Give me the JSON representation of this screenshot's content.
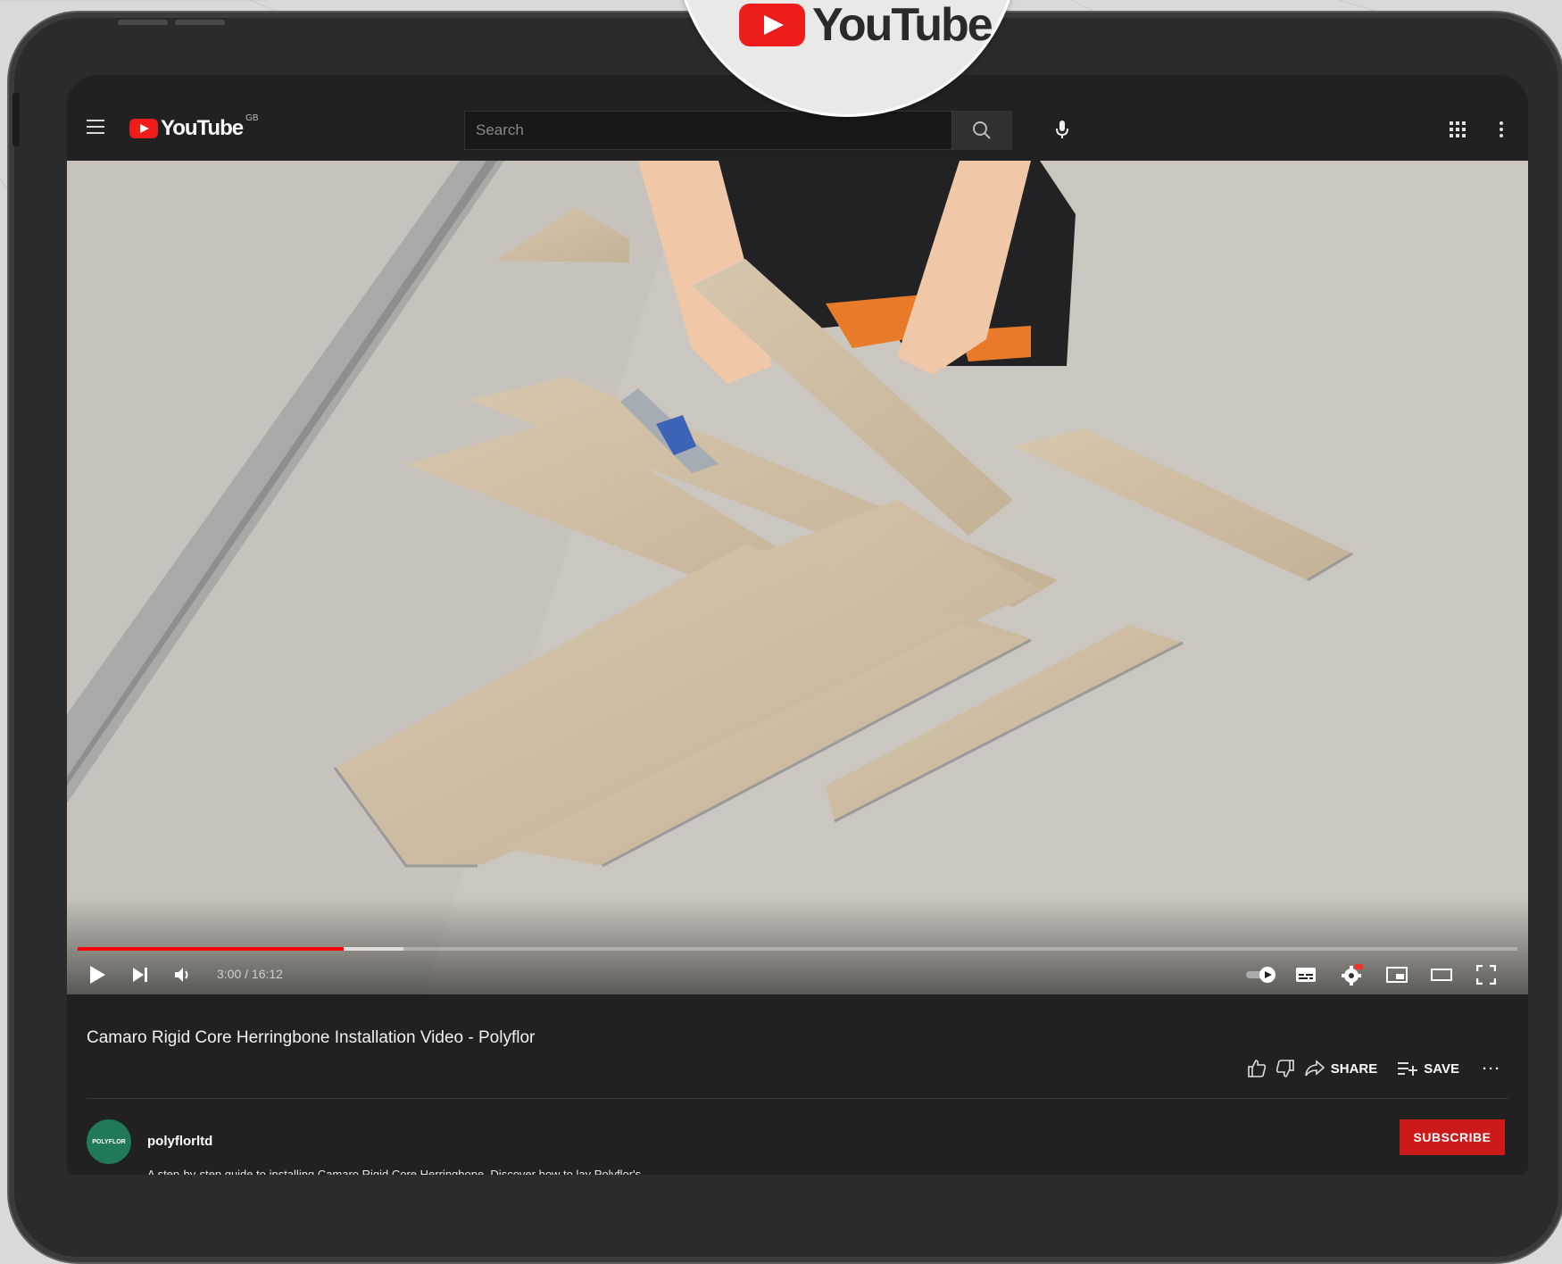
{
  "brand": {
    "name": "YouTube",
    "region": "GB",
    "accent": "#ff0000"
  },
  "banner": {
    "logo_text": "YouTube"
  },
  "search": {
    "placeholder": "Search"
  },
  "player": {
    "current_time": "3:00",
    "duration": "16:12",
    "time_display": "3:00 / 16:12",
    "played_fraction": 0.185,
    "buffered_fraction": 0.226
  },
  "video": {
    "title": "Camaro Rigid Core Herringbone Installation Video - Polyflor",
    "actions": {
      "share": "SHARE",
      "save": "SAVE"
    }
  },
  "channel": {
    "name": "polyflorltd",
    "avatar_text": "POLYFLOR",
    "subscribe": "SUBSCRIBE",
    "description": "A step-by-step guide to installing Camaro Rigid Core Herringbone. Discover how to lay Polyflor's"
  },
  "icons": [
    "menu-icon",
    "search-icon",
    "mic-icon",
    "apps-icon",
    "more-icon",
    "play-icon",
    "next-icon",
    "volume-icon",
    "autoplay-toggle",
    "subtitles-icon",
    "settings-icon",
    "miniplayer-icon",
    "theater-icon",
    "fullscreen-icon",
    "like-icon",
    "dislike-icon",
    "share-icon",
    "save-icon",
    "more-actions-icon"
  ]
}
